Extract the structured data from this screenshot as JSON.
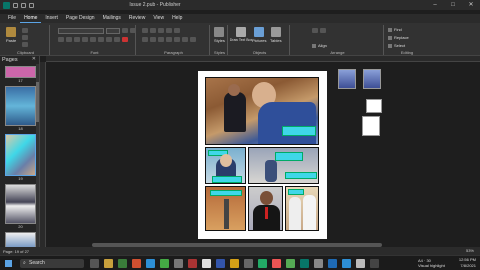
{
  "titlebar": {
    "title": "Issue 2.pub - Publisher"
  },
  "tabs": [
    "File",
    "Home",
    "Insert",
    "Page Design",
    "Mailings",
    "Review",
    "View",
    "Help"
  ],
  "ribbon": {
    "clipboard": {
      "paste": "Paste",
      "label": "Clipboard"
    },
    "font": {
      "label": "Font"
    },
    "paragraph": {
      "label": "Paragraph"
    },
    "styles": {
      "button": "Styles",
      "label": "Styles"
    },
    "objects": {
      "draw_text_box": "Draw Text Box",
      "pictures": "Pictures",
      "tables": "Tables",
      "label": "Objects"
    },
    "arrange": {
      "align": "Align",
      "label": "Arrange"
    },
    "editing": {
      "find": "Find",
      "replace": "Replace",
      "select": "Select",
      "label": "Editing"
    }
  },
  "pages_pane": {
    "title": "Pages",
    "thumbs": [
      {
        "num": "17"
      },
      {
        "num": "18"
      },
      {
        "num": "19"
      },
      {
        "num": "20"
      },
      {
        "num": "21"
      }
    ]
  },
  "status": {
    "page": "Page: 19 of 27",
    "zoom": "53%"
  },
  "taskbar": {
    "search": "Search",
    "weather": {
      "temp": "A4 · 30",
      "desc": "Visual highlight"
    },
    "time": "12:56 PM",
    "date": "7/8/2021"
  },
  "colors": {
    "accent": "#5ba4e6",
    "caption": "#3fd7e8",
    "publisher": "#077568"
  }
}
